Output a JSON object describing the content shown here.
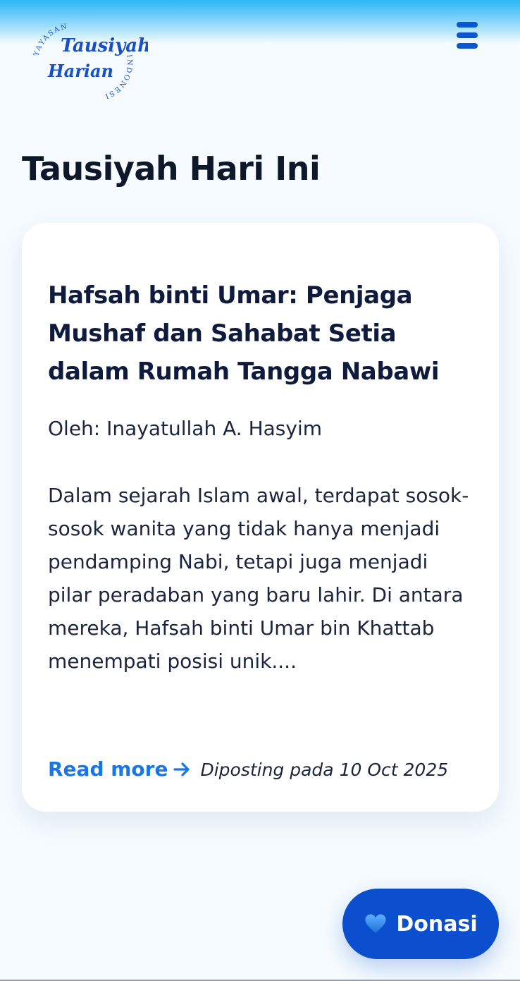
{
  "header": {
    "logo": {
      "arc_top": "YAYASAN",
      "line1": "Tausiyah",
      "line2": "Harian",
      "arc_side": "INDONESIA"
    },
    "menu_icon": "hamburger-menu-icon"
  },
  "page_title": "Tausiyah Hari Ini",
  "post": {
    "title": "Hafsah binti Umar: Penjaga Mushaf dan Sahabat Setia dalam Rumah Tangga Nabawi",
    "author": "Oleh: Inayatullah A. Hasyim",
    "excerpt": "Dalam sejarah Islam awal, terdapat sosok-sosok wanita yang tidak hanya menjadi pendamping Nabi, tetapi juga menjadi pilar peradaban yang baru lahir. Di antara mereka, Hafsah binti Umar bin Khattab menempati posisi unik....",
    "read_more_label": "Read more",
    "posted_label": "Diposting pada 10 Oct 2025"
  },
  "donate_button": {
    "label": "Donasi",
    "icon": "blue-heart-icon"
  },
  "colors": {
    "accent": "#1877e8",
    "brand": "#0b4fcf",
    "top_gradient": "#2bb6f5",
    "background": "#f5fbfe"
  }
}
